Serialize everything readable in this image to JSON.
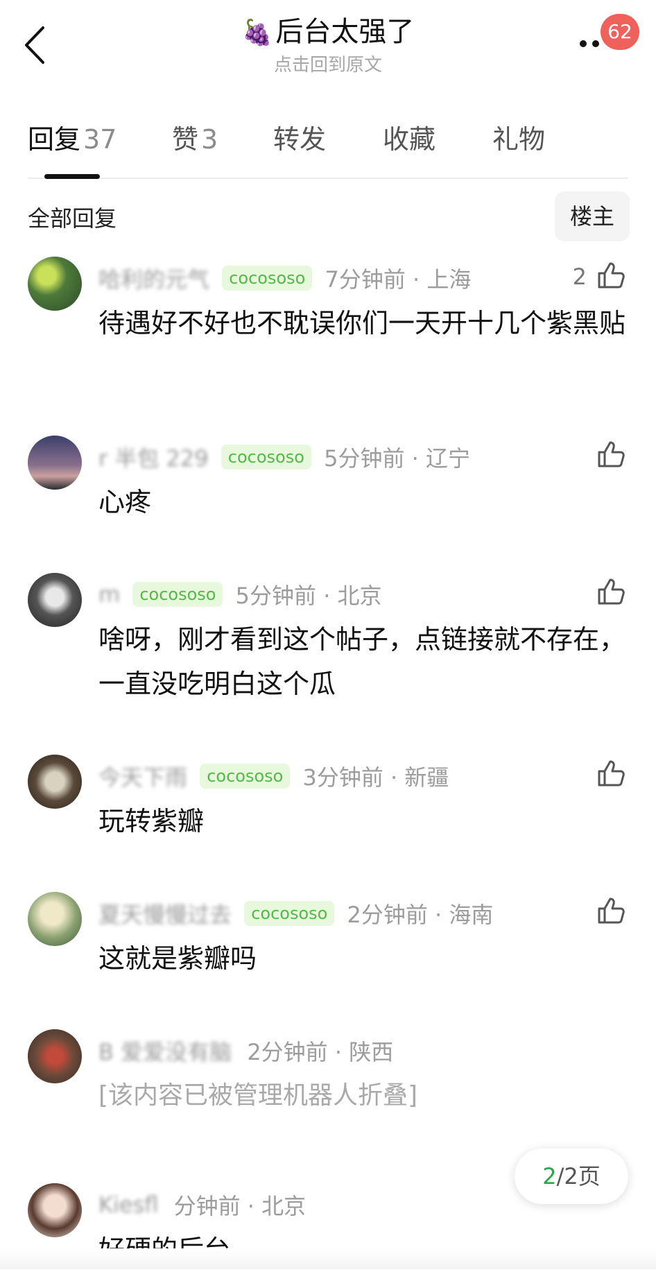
{
  "header": {
    "title_emoji": "🍇",
    "title": "后台太强了",
    "subtitle": "点击回到原文",
    "badge_count": "62"
  },
  "tabs": [
    {
      "label": "回复",
      "count": "37",
      "active": true
    },
    {
      "label": "赞",
      "count": "3",
      "active": false
    },
    {
      "label": "转发",
      "count": "",
      "active": false
    },
    {
      "label": "收藏",
      "count": "",
      "active": false
    },
    {
      "label": "礼物",
      "count": "",
      "active": false
    }
  ],
  "filter": {
    "label": "全部回复",
    "op_button": "楼主"
  },
  "comments": [
    {
      "name": "哈利的元气",
      "tag": "cocososo",
      "time": "7分钟前 · 上海",
      "likes": "2",
      "text": "待遇好不好也不耽误你们一天开十几个紫黑贴"
    },
    {
      "name": "r 半包 229",
      "tag": "cocososo",
      "time": "5分钟前 · 辽宁",
      "likes": "",
      "text": "心疼"
    },
    {
      "name": "m",
      "tag": "cocososo",
      "time": "5分钟前 · 北京",
      "likes": "",
      "text": "啥呀，刚才看到这个帖子，点链接就不存在，一直没吃明白这个瓜"
    },
    {
      "name": "今天下雨",
      "tag": "cocososo",
      "time": "3分钟前 · 新疆",
      "likes": "",
      "text": "玩转紫瓣"
    },
    {
      "name": "夏天慢慢过去",
      "tag": "cocososo",
      "time": "2分钟前 · 海南",
      "likes": "",
      "text": "这就是紫瓣吗"
    },
    {
      "name": "B 爱爱没有脑",
      "tag": "",
      "time": "2分钟前 · 陕西",
      "likes": "",
      "text": "[该内容已被管理机器人折叠]",
      "folded": true
    },
    {
      "name": "Kiesfl",
      "tag": "",
      "time": "分钟前 · 北京",
      "likes": "",
      "text": "好硬的后台"
    }
  ],
  "pager": {
    "current": "2",
    "rest": "/2页"
  },
  "colors": {
    "tag_bg": "#e7f8dc",
    "tag_text": "#55b84a",
    "badge": "#f0615c",
    "pager_current": "#2aa74a"
  }
}
